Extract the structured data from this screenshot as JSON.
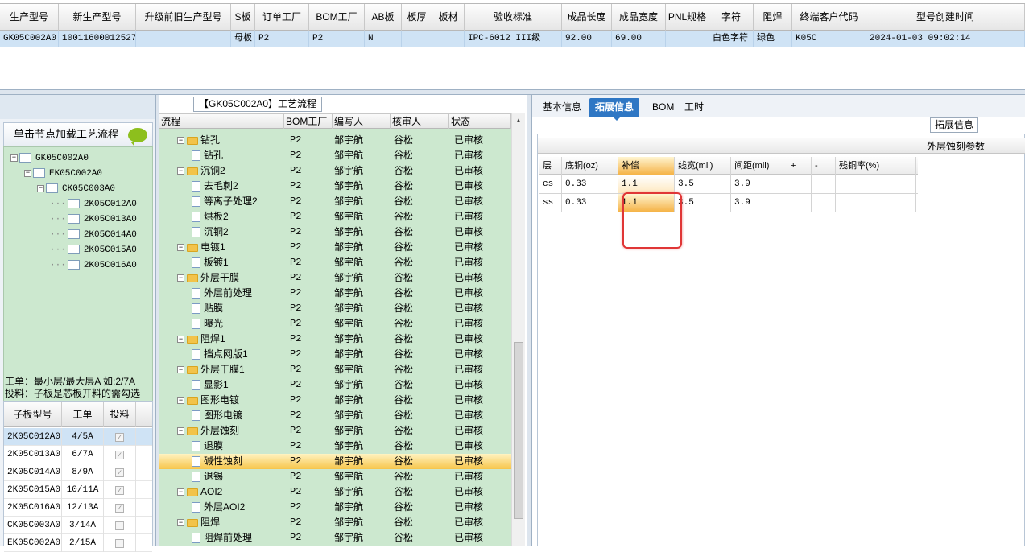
{
  "top_grid": {
    "headers": [
      "生产型号",
      "新生产型号",
      "升级前旧生产型号",
      "S板",
      "订单工厂",
      "BOM工厂",
      "AB板",
      "板厚",
      "板材",
      "验收标准",
      "成品长度",
      "成品宽度",
      "PNL规格",
      "字符",
      "阻焊",
      "终端客户代码",
      "型号创建时间"
    ],
    "row": [
      "GK05C002A0",
      "10011600012527",
      "",
      "母板",
      "P2",
      "P2",
      "N",
      "",
      "",
      "IPC-6012 III级",
      "92.00",
      "69.00",
      "",
      "白色字符",
      "绿色",
      "K05C",
      "2024-01-03 09:02:14"
    ]
  },
  "left_panel": {
    "load_button": "单击节点加载工艺流程",
    "tree": [
      "GK05C002A0",
      "EK05C002A0",
      "CK05C003A0",
      "2K05C012A0",
      "2K05C013A0",
      "2K05C014A0",
      "2K05C015A0",
      "2K05C016A0"
    ],
    "note_line1": "工单：最小层/最大层A 如:2/7A",
    "note_line2": "投料：子板是芯板开料的需勾选",
    "sub_headers": [
      "子板型号",
      "工单",
      "投料"
    ],
    "sub_rows": [
      {
        "model": "2K05C012A0",
        "order": "4/5A",
        "checked": true
      },
      {
        "model": "2K05C013A0",
        "order": "6/7A",
        "checked": true
      },
      {
        "model": "2K05C014A0",
        "order": "8/9A",
        "checked": true
      },
      {
        "model": "2K05C015A0",
        "order": "10/11A",
        "checked": true
      },
      {
        "model": "2K05C016A0",
        "order": "12/13A",
        "checked": true
      },
      {
        "model": "CK05C003A0",
        "order": "3/14A",
        "checked": false
      },
      {
        "model": "EK05C002A0",
        "order": "2/15A",
        "checked": false
      }
    ]
  },
  "mid_panel": {
    "title": "【GK05C002A0】工艺流程",
    "headers": [
      "流程",
      "BOM工厂",
      "编写人",
      "核审人",
      "状态"
    ],
    "rows": [
      {
        "name": "钻孔",
        "level": 0,
        "bom": "P2",
        "writer": "邹宇航",
        "reviewer": "谷松",
        "status": "已审核"
      },
      {
        "name": "钻孔",
        "level": 1,
        "bom": "P2",
        "writer": "邹宇航",
        "reviewer": "谷松",
        "status": "已审核"
      },
      {
        "name": "沉铜2",
        "level": 0,
        "bom": "P2",
        "writer": "邹宇航",
        "reviewer": "谷松",
        "status": "已审核"
      },
      {
        "name": "去毛刺2",
        "level": 1,
        "bom": "P2",
        "writer": "邹宇航",
        "reviewer": "谷松",
        "status": "已审核"
      },
      {
        "name": "等离子处理2",
        "level": 1,
        "bom": "P2",
        "writer": "邹宇航",
        "reviewer": "谷松",
        "status": "已审核"
      },
      {
        "name": "烘板2",
        "level": 1,
        "bom": "P2",
        "writer": "邹宇航",
        "reviewer": "谷松",
        "status": "已审核"
      },
      {
        "name": "沉铜2",
        "level": 1,
        "bom": "P2",
        "writer": "邹宇航",
        "reviewer": "谷松",
        "status": "已审核"
      },
      {
        "name": "电镀1",
        "level": 0,
        "bom": "P2",
        "writer": "邹宇航",
        "reviewer": "谷松",
        "status": "已审核"
      },
      {
        "name": "板镀1",
        "level": 1,
        "bom": "P2",
        "writer": "邹宇航",
        "reviewer": "谷松",
        "status": "已审核"
      },
      {
        "name": "外层干膜",
        "level": 0,
        "bom": "P2",
        "writer": "邹宇航",
        "reviewer": "谷松",
        "status": "已审核"
      },
      {
        "name": "外层前处理",
        "level": 1,
        "bom": "P2",
        "writer": "邹宇航",
        "reviewer": "谷松",
        "status": "已审核"
      },
      {
        "name": "贴膜",
        "level": 1,
        "bom": "P2",
        "writer": "邹宇航",
        "reviewer": "谷松",
        "status": "已审核"
      },
      {
        "name": "曝光",
        "level": 1,
        "bom": "P2",
        "writer": "邹宇航",
        "reviewer": "谷松",
        "status": "已审核"
      },
      {
        "name": "阻焊1",
        "level": 0,
        "bom": "P2",
        "writer": "邹宇航",
        "reviewer": "谷松",
        "status": "已审核"
      },
      {
        "name": "挡点网版1",
        "level": 1,
        "bom": "P2",
        "writer": "邹宇航",
        "reviewer": "谷松",
        "status": "已审核"
      },
      {
        "name": "外层干膜1",
        "level": 0,
        "bom": "P2",
        "writer": "邹宇航",
        "reviewer": "谷松",
        "status": "已审核"
      },
      {
        "name": "显影1",
        "level": 1,
        "bom": "P2",
        "writer": "邹宇航",
        "reviewer": "谷松",
        "status": "已审核"
      },
      {
        "name": "图形电镀",
        "level": 0,
        "bom": "P2",
        "writer": "邹宇航",
        "reviewer": "谷松",
        "status": "已审核"
      },
      {
        "name": "图形电镀",
        "level": 1,
        "bom": "P2",
        "writer": "邹宇航",
        "reviewer": "谷松",
        "status": "已审核"
      },
      {
        "name": "外层蚀刻",
        "level": 0,
        "bom": "P2",
        "writer": "邹宇航",
        "reviewer": "谷松",
        "status": "已审核"
      },
      {
        "name": "退膜",
        "level": 1,
        "bom": "P2",
        "writer": "邹宇航",
        "reviewer": "谷松",
        "status": "已审核"
      },
      {
        "name": "碱性蚀刻",
        "level": 1,
        "bom": "P2",
        "writer": "邹宇航",
        "reviewer": "谷松",
        "status": "已审核",
        "selected": true
      },
      {
        "name": "退锡",
        "level": 1,
        "bom": "P2",
        "writer": "邹宇航",
        "reviewer": "谷松",
        "status": "已审核"
      },
      {
        "name": "AOI2",
        "level": 0,
        "bom": "P2",
        "writer": "邹宇航",
        "reviewer": "谷松",
        "status": "已审核"
      },
      {
        "name": "外层AOI2",
        "level": 1,
        "bom": "P2",
        "writer": "邹宇航",
        "reviewer": "谷松",
        "status": "已审核"
      },
      {
        "name": "阻焊",
        "level": 0,
        "bom": "P2",
        "writer": "邹宇航",
        "reviewer": "谷松",
        "status": "已审核"
      },
      {
        "name": "阻焊前处理",
        "level": 1,
        "bom": "P2",
        "writer": "邹宇航",
        "reviewer": "谷松",
        "status": "已审核"
      }
    ]
  },
  "right_panel": {
    "tabs": [
      "基本信息",
      "拓展信息",
      "BOM",
      "工时"
    ],
    "active_tab": 1,
    "label": "拓展信息",
    "group_title": "外层蚀刻参数",
    "headers": [
      "层",
      "底铜(oz)",
      "补偿",
      "线宽(mil)",
      "间距(mil)",
      "+",
      "-",
      "残铜率(%)"
    ],
    "rows": [
      [
        "cs",
        "0.33",
        "1.1",
        "3.5",
        "3.9",
        "",
        "",
        ""
      ],
      [
        "ss",
        "0.33",
        "1.1",
        "3.5",
        "3.9",
        "",
        "",
        ""
      ]
    ]
  }
}
